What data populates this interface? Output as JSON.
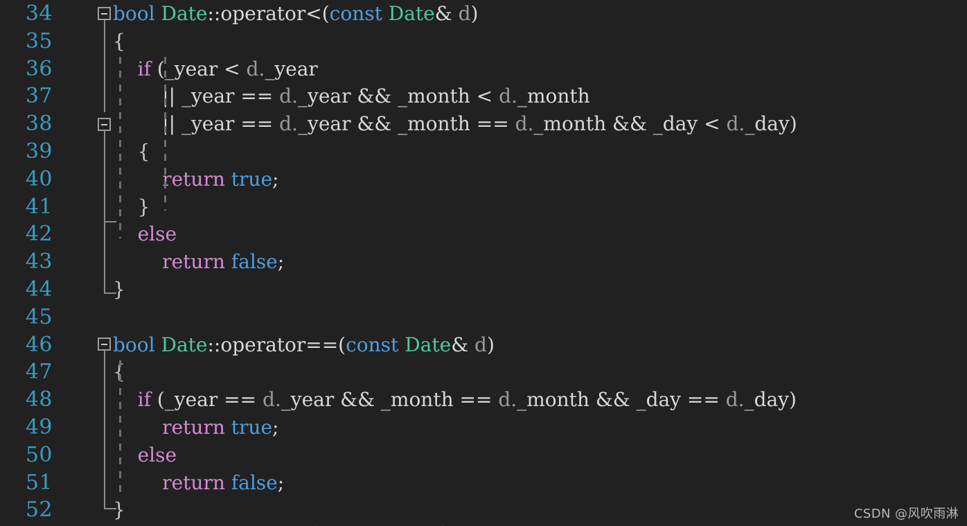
{
  "editor": {
    "background_color": "#212121",
    "line_number_color": "#3a9bc1",
    "first_line_number": 34,
    "last_line_number": 52
  },
  "colors": {
    "keyword": "#4d9fe0",
    "control": "#d68ad4",
    "type": "#4ec9a0",
    "plain": "#d8d8d8",
    "object": "#9a9a9a",
    "fold_marker": "#9d9d9d",
    "indent_guide": "#6e6e6e"
  },
  "lines": [
    {
      "number": "34",
      "text": "bool Date::operator<(const Date& d)"
    },
    {
      "number": "35",
      "text": "{"
    },
    {
      "number": "36",
      "text": "    if (_year < d._year"
    },
    {
      "number": "37",
      "text": "        || _year == d._year && _month < d._month"
    },
    {
      "number": "38",
      "text": "        || _year == d._year && _month == d._month && _day < d._day)"
    },
    {
      "number": "39",
      "text": "    {"
    },
    {
      "number": "40",
      "text": "        return true;"
    },
    {
      "number": "41",
      "text": "    }"
    },
    {
      "number": "42",
      "text": "    else"
    },
    {
      "number": "43",
      "text": "        return false;"
    },
    {
      "number": "44",
      "text": "}"
    },
    {
      "number": "45",
      "text": ""
    },
    {
      "number": "46",
      "text": "bool Date::operator==(const Date& d)"
    },
    {
      "number": "47",
      "text": "{"
    },
    {
      "number": "48",
      "text": "    if (_year == d._year && _month == d._month && _day == d._day)"
    },
    {
      "number": "49",
      "text": "        return true;"
    },
    {
      "number": "50",
      "text": "    else"
    },
    {
      "number": "51",
      "text": "        return false;"
    },
    {
      "number": "52",
      "text": "}"
    }
  ],
  "tokens": {
    "l34": [
      {
        "t": "bool",
        "c": "t-kw"
      },
      {
        "t": " ",
        "c": "t-plain"
      },
      {
        "t": "Date",
        "c": "t-type"
      },
      {
        "t": "::operator<(",
        "c": "t-plain"
      },
      {
        "t": "const",
        "c": "t-kw"
      },
      {
        "t": " ",
        "c": "t-plain"
      },
      {
        "t": "Date",
        "c": "t-type"
      },
      {
        "t": "& ",
        "c": "t-plain"
      },
      {
        "t": "d",
        "c": "t-obj"
      },
      {
        "t": ")",
        "c": "t-plain"
      }
    ],
    "l35": [
      {
        "t": "{",
        "c": "t-brace"
      }
    ],
    "l36": [
      {
        "t": "    ",
        "c": "t-plain"
      },
      {
        "t": "if",
        "c": "t-ctrl"
      },
      {
        "t": " (_year < ",
        "c": "t-plain"
      },
      {
        "t": "d.",
        "c": "t-obj"
      },
      {
        "t": "_year",
        "c": "t-plain"
      }
    ],
    "l37": [
      {
        "t": "        || _year == ",
        "c": "t-plain"
      },
      {
        "t": "d.",
        "c": "t-obj"
      },
      {
        "t": "_year && _month < ",
        "c": "t-plain"
      },
      {
        "t": "d.",
        "c": "t-obj"
      },
      {
        "t": "_month",
        "c": "t-plain"
      }
    ],
    "l38": [
      {
        "t": "        || _year == ",
        "c": "t-plain"
      },
      {
        "t": "d.",
        "c": "t-obj"
      },
      {
        "t": "_year && _month == ",
        "c": "t-plain"
      },
      {
        "t": "d.",
        "c": "t-obj"
      },
      {
        "t": "_month && _day < ",
        "c": "t-plain"
      },
      {
        "t": "d.",
        "c": "t-obj"
      },
      {
        "t": "_day)",
        "c": "t-plain"
      }
    ],
    "l39": [
      {
        "t": "    {",
        "c": "t-brace"
      }
    ],
    "l40": [
      {
        "t": "        ",
        "c": "t-plain"
      },
      {
        "t": "return",
        "c": "t-ctrl"
      },
      {
        "t": " ",
        "c": "t-plain"
      },
      {
        "t": "true",
        "c": "t-kw"
      },
      {
        "t": ";",
        "c": "t-plain"
      }
    ],
    "l41": [
      {
        "t": "    }",
        "c": "t-brace"
      }
    ],
    "l42": [
      {
        "t": "    ",
        "c": "t-plain"
      },
      {
        "t": "else",
        "c": "t-ctrl"
      }
    ],
    "l43": [
      {
        "t": "        ",
        "c": "t-plain"
      },
      {
        "t": "return",
        "c": "t-ctrl"
      },
      {
        "t": " ",
        "c": "t-plain"
      },
      {
        "t": "false",
        "c": "t-kw"
      },
      {
        "t": ";",
        "c": "t-plain"
      }
    ],
    "l44": [
      {
        "t": "}",
        "c": "t-brace"
      }
    ],
    "l45": [],
    "l46": [
      {
        "t": "bool",
        "c": "t-kw"
      },
      {
        "t": " ",
        "c": "t-plain"
      },
      {
        "t": "Date",
        "c": "t-type"
      },
      {
        "t": "::operator==(",
        "c": "t-plain"
      },
      {
        "t": "const",
        "c": "t-kw"
      },
      {
        "t": " ",
        "c": "t-plain"
      },
      {
        "t": "Date",
        "c": "t-type"
      },
      {
        "t": "& ",
        "c": "t-plain"
      },
      {
        "t": "d",
        "c": "t-obj"
      },
      {
        "t": ")",
        "c": "t-plain"
      }
    ],
    "l47": [
      {
        "t": "{",
        "c": "t-brace"
      }
    ],
    "l48": [
      {
        "t": "    ",
        "c": "t-plain"
      },
      {
        "t": "if",
        "c": "t-ctrl"
      },
      {
        "t": " (_year == ",
        "c": "t-plain"
      },
      {
        "t": "d.",
        "c": "t-obj"
      },
      {
        "t": "_year && _month == ",
        "c": "t-plain"
      },
      {
        "t": "d.",
        "c": "t-obj"
      },
      {
        "t": "_month && _day == ",
        "c": "t-plain"
      },
      {
        "t": "d.",
        "c": "t-obj"
      },
      {
        "t": "_day)",
        "c": "t-plain"
      }
    ],
    "l49": [
      {
        "t": "        ",
        "c": "t-plain"
      },
      {
        "t": "return",
        "c": "t-ctrl"
      },
      {
        "t": " ",
        "c": "t-plain"
      },
      {
        "t": "true",
        "c": "t-kw"
      },
      {
        "t": ";",
        "c": "t-plain"
      }
    ],
    "l50": [
      {
        "t": "    ",
        "c": "t-plain"
      },
      {
        "t": "else",
        "c": "t-ctrl"
      }
    ],
    "l51": [
      {
        "t": "        ",
        "c": "t-plain"
      },
      {
        "t": "return",
        "c": "t-ctrl"
      },
      {
        "t": " ",
        "c": "t-plain"
      },
      {
        "t": "false",
        "c": "t-kw"
      },
      {
        "t": ";",
        "c": "t-plain"
      }
    ],
    "l52": [
      {
        "t": "}",
        "c": "t-brace"
      }
    ]
  },
  "watermark": {
    "text": "CSDN @风吹雨淋"
  }
}
